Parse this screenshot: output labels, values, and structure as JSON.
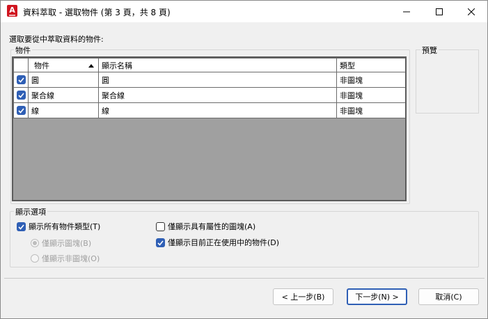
{
  "window": {
    "title": "資料萃取 - 選取物件 (第 3 頁，共 8 頁)",
    "app_icon_letter": "A"
  },
  "prompt": "選取要從中萃取資料的物件:",
  "objects_group": {
    "label": "物件",
    "columns": [
      "物件",
      "顯示名稱",
      "類型"
    ],
    "rows": [
      {
        "checked": true,
        "object": "圓",
        "display_name": "圓",
        "type": "非圖塊"
      },
      {
        "checked": true,
        "object": "聚合線",
        "display_name": "聚合線",
        "type": "非圖塊"
      },
      {
        "checked": true,
        "object": "線",
        "display_name": "線",
        "type": "非圖塊"
      }
    ]
  },
  "preview_group": {
    "label": "預覽"
  },
  "display_options": {
    "label": "顯示選項",
    "show_all_types": "顯示所有物件類型(T)",
    "only_blocks": "僅顯示圖塊(B)",
    "only_non_blocks": "僅顯示非圖塊(O)",
    "only_blocks_with_attributes": "僅顯示具有屬性的圖塊(A)",
    "only_objects_in_use": "僅顯示目前正在使用中的物件(D)"
  },
  "buttons": {
    "back": "< 上一步(B)",
    "next": "下一步(N) >",
    "cancel": "取消(C)"
  },
  "colors": {
    "accent": "#2f5fb5",
    "app_icon": "#d0141f",
    "grid_empty": "#a0a0a0"
  }
}
